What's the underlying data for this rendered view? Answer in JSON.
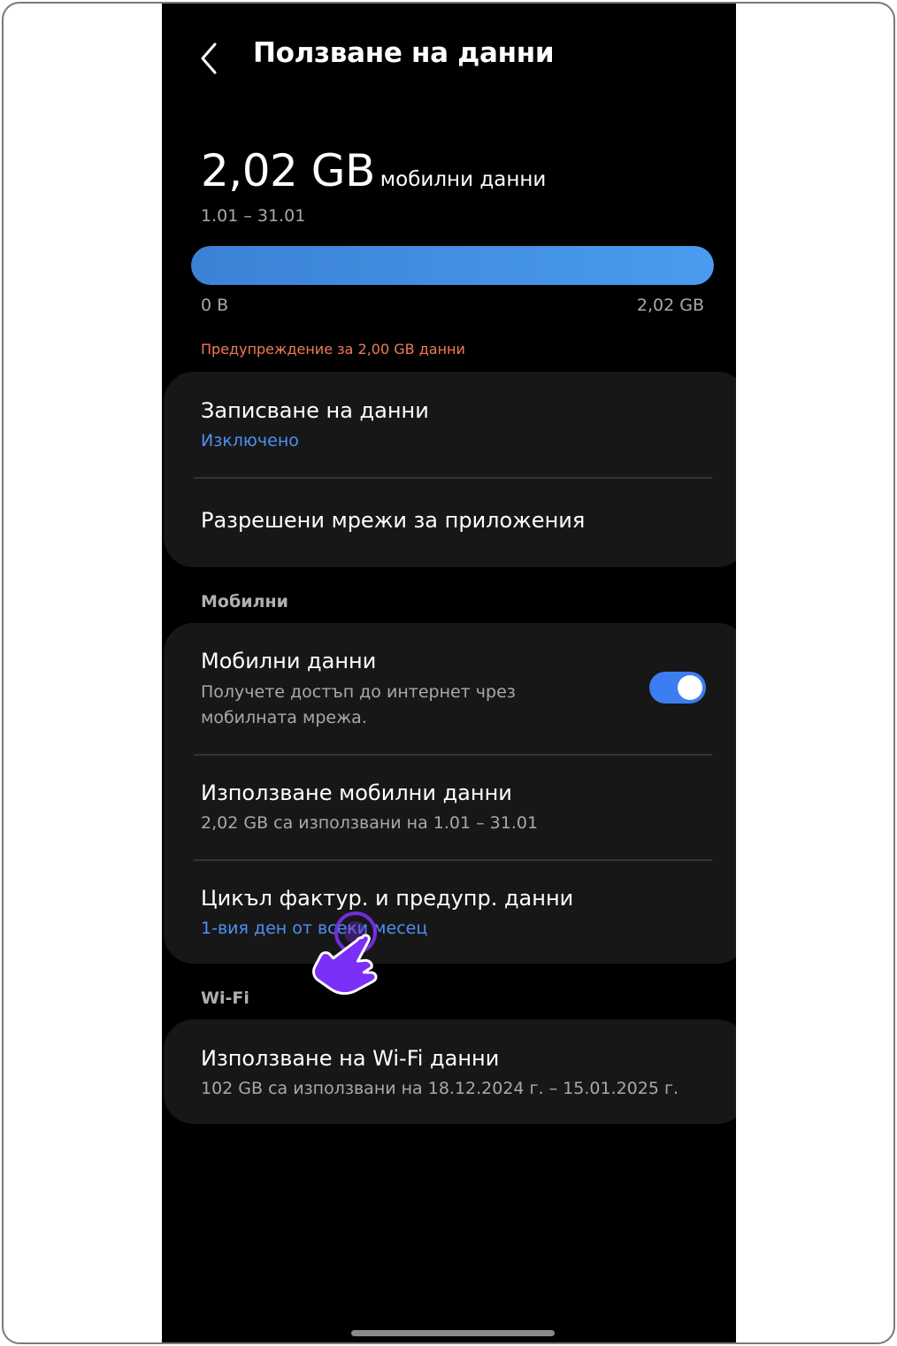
{
  "header": {
    "title": "Ползване на данни"
  },
  "summary": {
    "amount": "2,02 GB",
    "unit": "мобилни данни",
    "period": "1.01 – 31.01",
    "bar_min": "0 B",
    "bar_max": "2,02 GB",
    "fill_fraction": 1.0,
    "warning": "Предупреждение за 2,00 GB данни"
  },
  "card1": {
    "saver_title": "Записване на данни",
    "saver_status": "Изключено",
    "allowed_networks": "Разрешени мрежи за приложения"
  },
  "mobile_section": {
    "label": "Мобилни",
    "mobile_data_title": "Мобилни данни",
    "mobile_data_desc_line1": "Получете достъп до интернет чрез",
    "mobile_data_desc_line2": "мобилната мрежа.",
    "mobile_data_enabled": true,
    "usage_title": "Използване мобилни данни",
    "usage_sub": "2,02 GB са използвани на 1.01 – 31.01",
    "cycle_title": "Цикъл фактур. и предупр. данни",
    "cycle_sub": "1-вия ден от всеки месец"
  },
  "wifi_section": {
    "label": "Wi-Fi",
    "usage_title": "Използване на Wi-Fi данни",
    "usage_sub": "102 GB са използвани на 18.12.2024 г. – 15.01.2025 г."
  },
  "colors": {
    "background": "#000000",
    "card": "#171717",
    "accent": "#4f8ff5",
    "warning": "#f07b58",
    "toggle_on": "#3d7df2",
    "pointer_hand": "#7b2ff7"
  },
  "icons": {
    "back": "chevron-left-icon",
    "pointer": "pointing-hand-icon"
  }
}
